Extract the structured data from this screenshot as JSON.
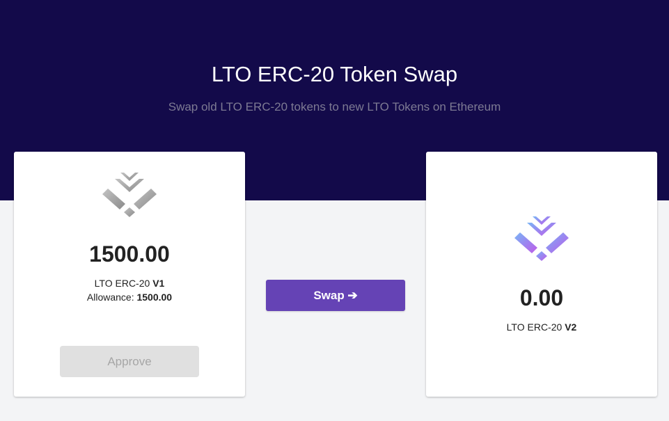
{
  "header": {
    "title": "LTO ERC-20 Token Swap",
    "subtitle": "Swap old LTO ERC-20 tokens to new LTO Tokens on Ethereum"
  },
  "source": {
    "logo_icon": "lto-logo-gray-icon",
    "amount": "1500.00",
    "token_prefix": "LTO ERC-20",
    "token_version": "V1",
    "allowance_label": "Allowance:",
    "allowance_value": "1500.00",
    "approve_label": "Approve"
  },
  "swap": {
    "label": "Swap ➔"
  },
  "target": {
    "logo_icon": "lto-logo-purple-icon",
    "amount": "0.00",
    "token_prefix": "LTO ERC-20",
    "token_version": "V2"
  },
  "colors": {
    "hero_bg": "#130a4a",
    "swap_button": "#6543b5",
    "disabled_button": "#e0e0e0",
    "page_bg": "#f3f4f6"
  }
}
